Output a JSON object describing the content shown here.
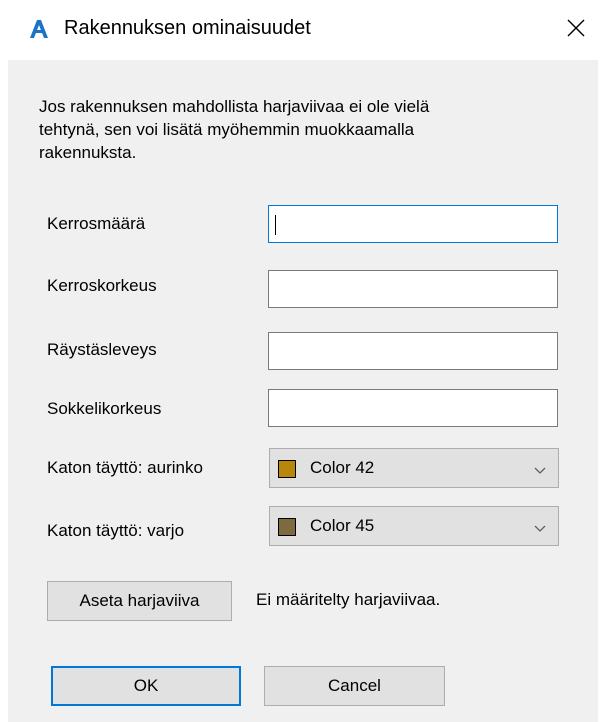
{
  "window": {
    "title": "Rakennuksen ominaisuudet",
    "app_icon": "autocad-a-icon",
    "close_icon": "close-icon"
  },
  "description": {
    "line1": "Jos rakennuksen mahdollista harjaviivaa ei ole vielä",
    "line2": "tehtynä, sen voi lisätä myöhemmin muokkaamalla",
    "line3": "rakennuksta."
  },
  "fields": {
    "kerrosmaara": {
      "label": "Kerrosmäärä",
      "value": ""
    },
    "kerroskorkeus": {
      "label": "Kerroskorkeus",
      "value": ""
    },
    "raystasleveys": {
      "label": "Räystäsleveys",
      "value": ""
    },
    "sokkelikorkeus": {
      "label": "Sokkelikorkeus",
      "value": ""
    }
  },
  "roof_fill": {
    "sun": {
      "label": "Katon täyttö: aurinko",
      "selected": "Color 42",
      "swatch_color": "#b8860b"
    },
    "shade": {
      "label": "Katon täyttö: varjo",
      "selected": "Color 45",
      "swatch_color": "#7f6a3f"
    }
  },
  "ridge": {
    "button_label": "Aseta harjaviiva",
    "status": "Ei määritelty harjaviivaa."
  },
  "buttons": {
    "ok": "OK",
    "cancel": "Cancel"
  },
  "colors": {
    "dialog_bg": "#f0f0f0",
    "focus_border": "#0078d7",
    "button_bg": "#e1e1e1",
    "app_icon_blue": "#1a73c6"
  }
}
